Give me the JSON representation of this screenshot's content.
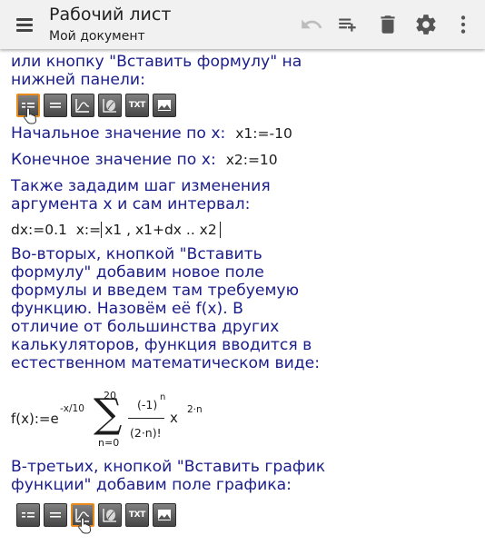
{
  "appbar": {
    "title": "Рабочий лист",
    "subtitle": "Мой документ",
    "icons": [
      "menu-icon",
      "undo-icon",
      "add-playlist-icon",
      "trash-icon",
      "settings-icon",
      "overflow-menu-icon"
    ]
  },
  "content": {
    "p1_line1": "или кнопку \"Вставить формулу\" на",
    "p1_line2": "нижней панели:",
    "toolbar1": [
      "formula-assign-icon",
      "formula-equals-icon",
      "plot-icon",
      "surface-plot-icon",
      "text-icon",
      "image-icon"
    ],
    "toolbar1_txt": "TXT",
    "start_label": "Начальное значение по x:",
    "start_formula": "x1:=-10",
    "end_label": "Конечное значение по x:",
    "end_formula": "x2:=10",
    "p2_line1": "Также зададим шаг изменения",
    "p2_line2": "аргумента x и сам интервал:",
    "step_formula_a": "dx:=0.1",
    "step_formula_b": "x:=",
    "step_formula_range": "x1 , x1+dx .. x2",
    "p3_lines": [
      "Во-вторых, кнопкой \"Вставить",
      "формулу\" добавим новое поле",
      "формулы и введем там требуемую",
      "функцию. Назовём её f(x). В",
      "отличие от большинства других",
      "калькуляторов, функция вводится в",
      "естественном математическом виде:"
    ],
    "formula": {
      "lhs": "f(x):=e",
      "exp": "-x/10",
      "sum_upper": "20",
      "sum_lower": "n=0",
      "numerator": "(-1)",
      "numerator_exp": "n",
      "denominator": "(2·n)!",
      "x": "x",
      "x_exp": "2·n"
    },
    "p4_line1": "В-третьих, кнопкой \"Вставить график",
    "p4_line2": "функции\" добавим поле графика:",
    "toolbar2_txt": "TXT"
  }
}
